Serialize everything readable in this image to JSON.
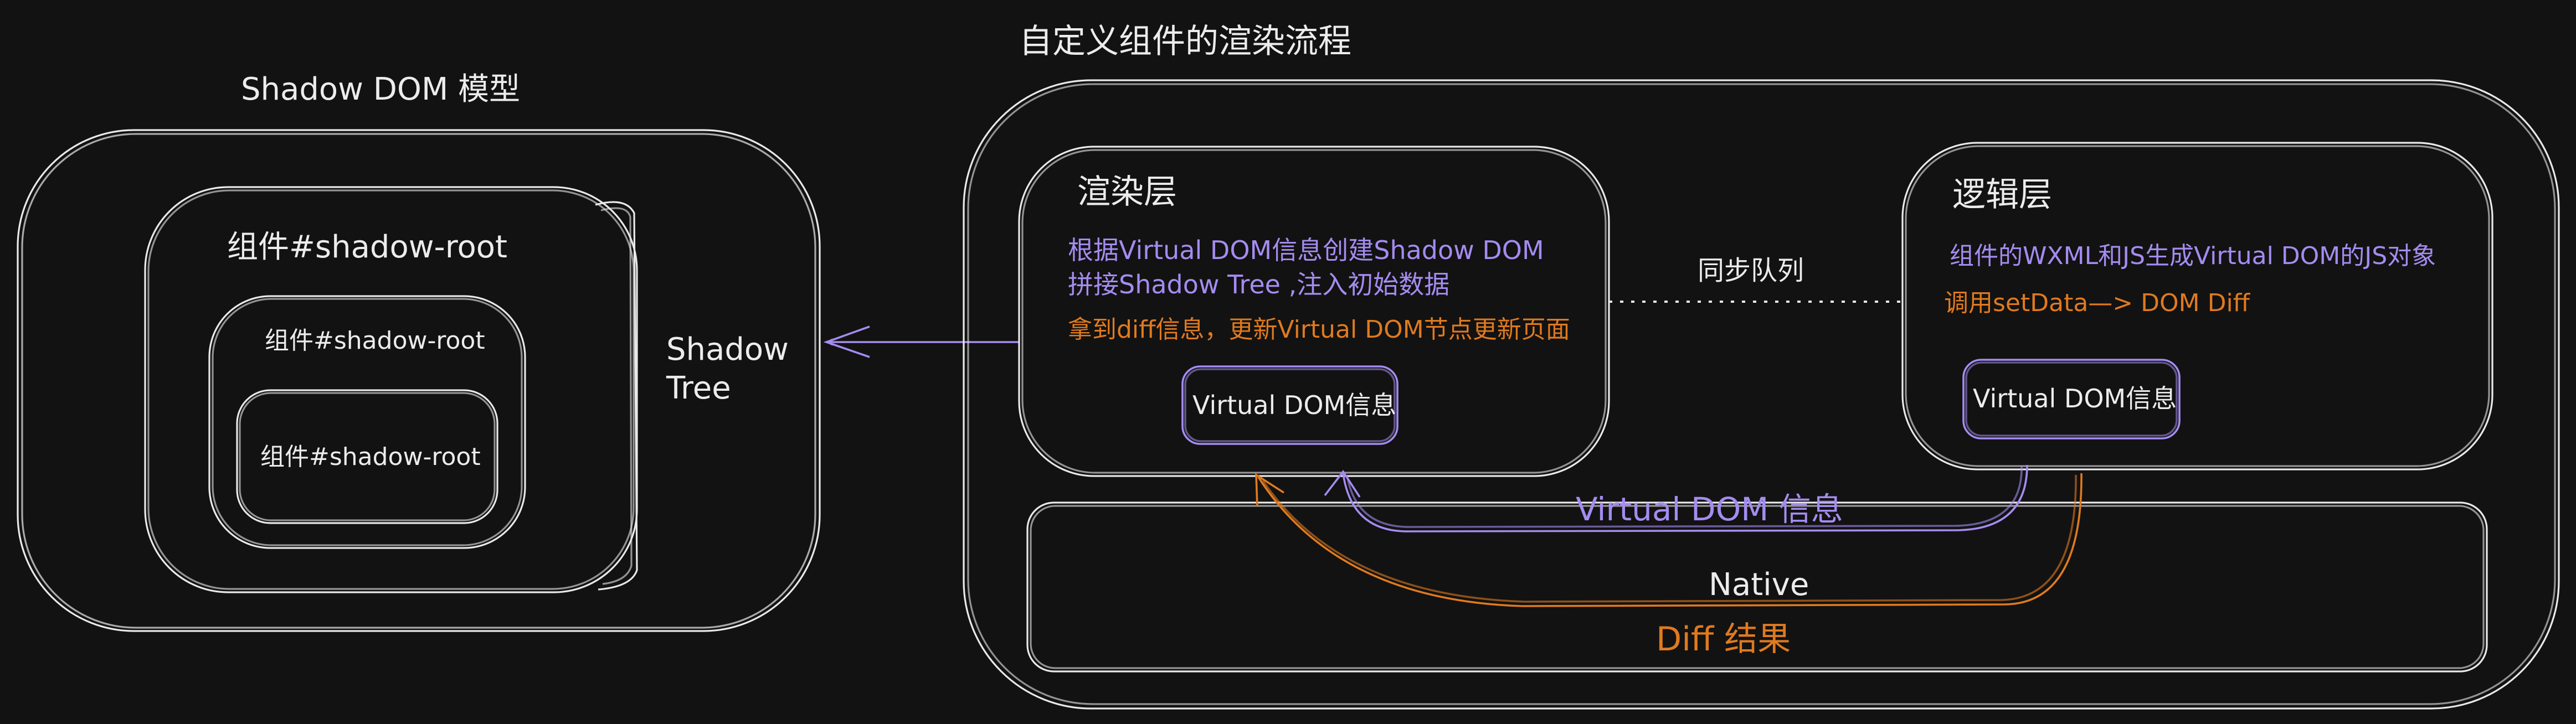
{
  "shadow_dom_model": {
    "title": "Shadow DOM 模型",
    "root_label": "组件#shadow-root",
    "mid_label": "组件#shadow-root",
    "inner_label": "组件#shadow-root",
    "tree_label_line1": "Shadow",
    "tree_label_line2": "Tree"
  },
  "render_flow": {
    "title": "自定义组件的渲染流程",
    "render_layer": {
      "title": "渲染层",
      "line1": "根据Virtual DOM信息创建Shadow DOM",
      "line2": "拼接Shadow Tree ,注入初始数据",
      "line3": "拿到diff信息，更新Virtual DOM节点更新页面",
      "vdom_box": "Virtual DOM信息"
    },
    "sync_queue_label": "同步队列",
    "logic_layer": {
      "title": "逻辑层",
      "line1": "组件的WXML和JS生成Virtual DOM的JS对象",
      "line2": "调用setData—> DOM Diff",
      "vdom_box": "Virtual DOM信息"
    },
    "native_label": "Native",
    "vdom_transfer_label": "Virtual DOM 信息",
    "diff_result_label": "Diff 结果"
  },
  "colors": {
    "background": "#121212",
    "stroke": "#e9e9e9",
    "purple": "#a48cf0",
    "orange": "#e07a1f"
  }
}
